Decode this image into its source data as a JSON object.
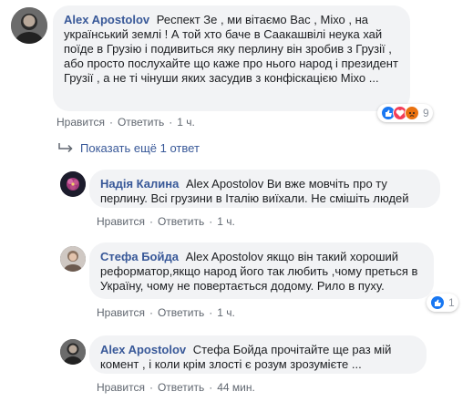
{
  "comments": [
    {
      "author": "Alex Apostolov",
      "text": "Респект Зе , ми вітаємо Вас , Міхо , на український землі ! А той хто баче в Саакашвілі неука хай поїде в Грузію і подивиться яку перлину він зробив з Грузії , або просто послухайте що каже про нього народ і президент Грузії , а не ті чінуши яких засудив з конфіскацією Міхо ...",
      "like_label": "Нравится",
      "reply_label": "Ответить",
      "time": "1 ч.",
      "reactions": {
        "count": "9",
        "types": [
          "like",
          "love",
          "angry"
        ]
      }
    }
  ],
  "more_replies_label": "Показать ещё 1 ответ",
  "replies": [
    {
      "author": "Надія Калина",
      "text": "Alex Apostolov Ви вже мовчіть про ту перлину. Всі грузини в Італію виїхали. Не смішіть людей",
      "like_label": "Нравится",
      "reply_label": "Ответить",
      "time": "1 ч."
    },
    {
      "author": "Стефа Бойда",
      "text": "Alex Apostolov якщо він такий хороший реформатор,якщо народ його так любить ,чому преться в Україну, чому не повертається додому. Рило в пуху.",
      "like_label": "Нравится",
      "reply_label": "Ответить",
      "time": "1 ч.",
      "reactions": {
        "count": "1",
        "types": [
          "like"
        ]
      }
    },
    {
      "author": "Alex Apostolov",
      "text": "Стефа Бойда прочітайте ще раз мій комент , і коли крім злості є розум зрозумієте ...",
      "like_label": "Нравится",
      "reply_label": "Ответить",
      "time": "44 мин."
    }
  ],
  "colors": {
    "link": "#385898",
    "bubble": "#f2f3f5",
    "meta": "#606770",
    "like": "#1877f2",
    "love": "#f33e58",
    "angry": "#e9710f"
  }
}
